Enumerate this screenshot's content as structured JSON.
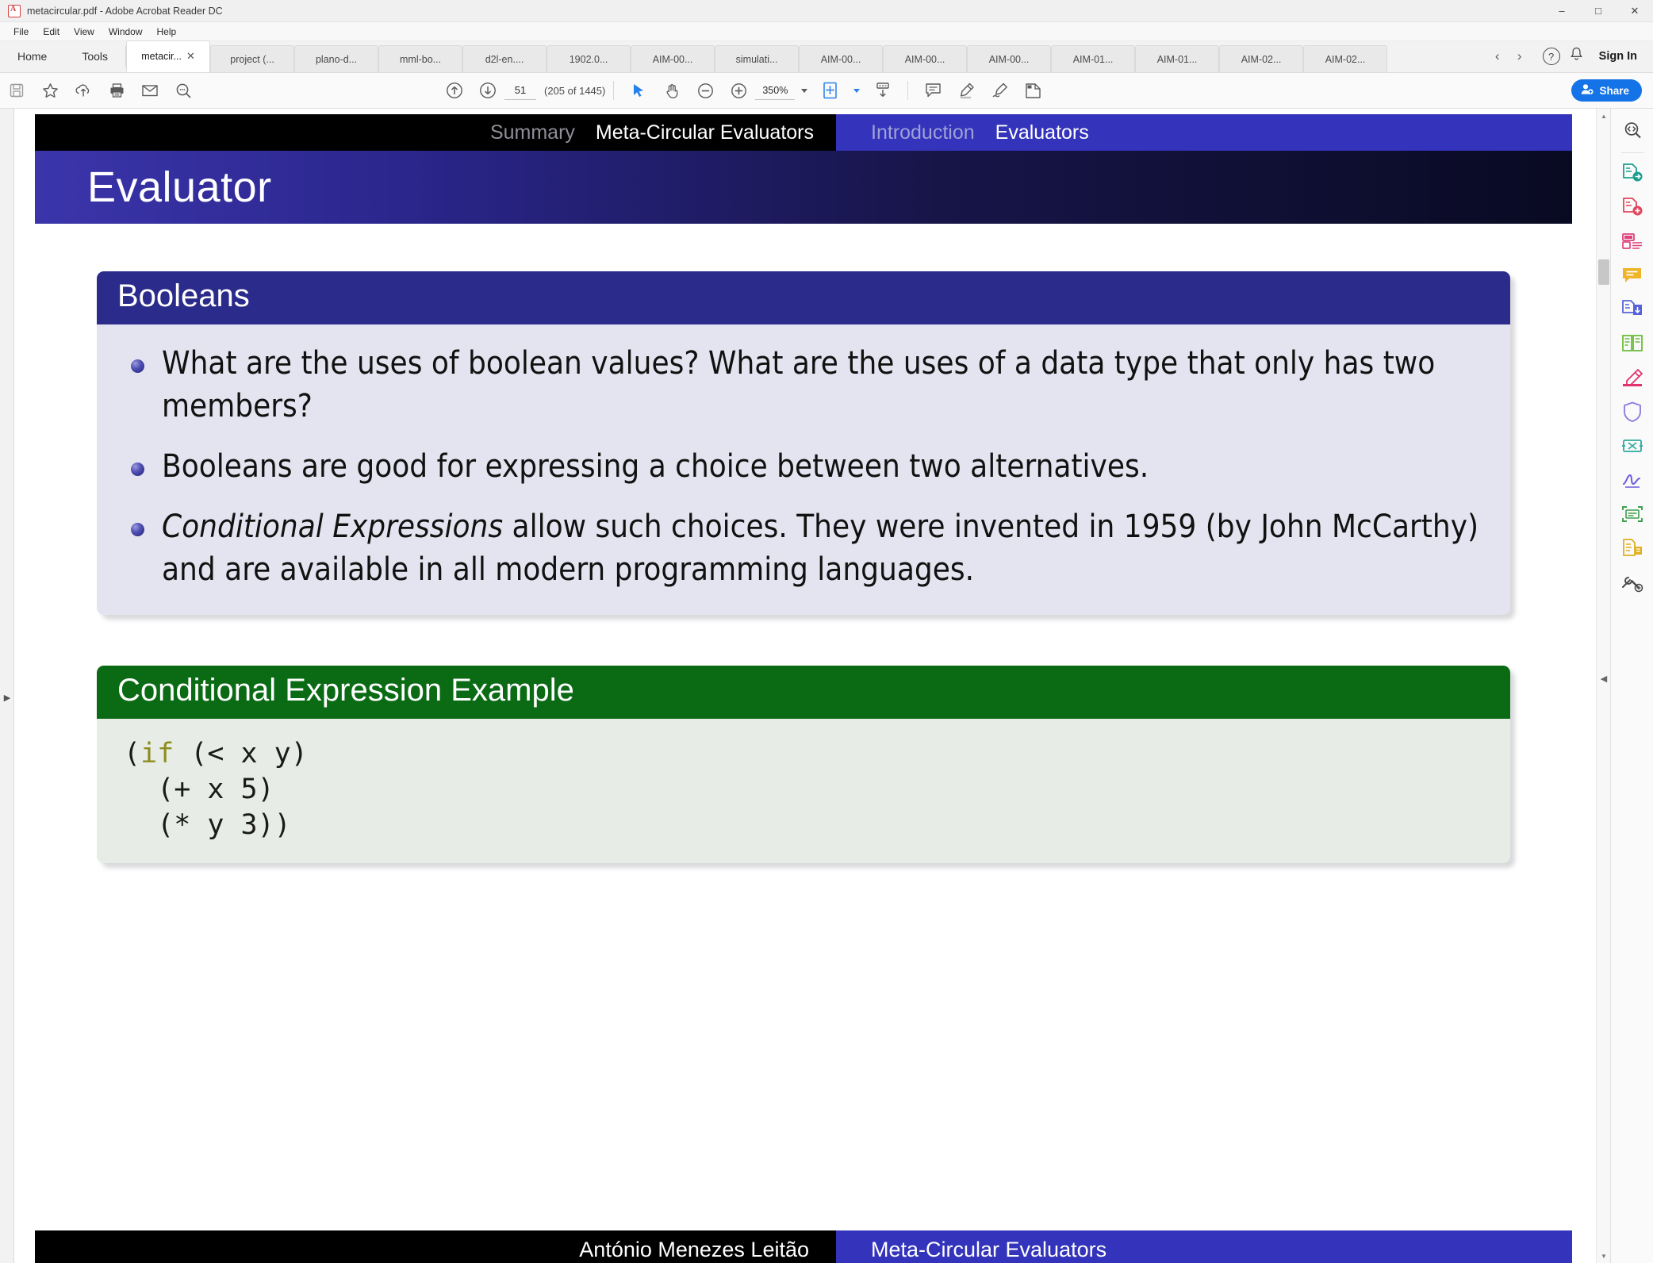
{
  "window": {
    "title": "metacircular.pdf - Adobe Acrobat Reader DC",
    "app_icon": "pdf-document-icon",
    "minimize": "–",
    "maximize": "□",
    "close": "✕"
  },
  "menubar": {
    "items": [
      {
        "label": "File"
      },
      {
        "label": "Edit"
      },
      {
        "label": "View"
      },
      {
        "label": "Window"
      },
      {
        "label": "Help"
      }
    ]
  },
  "tabbar": {
    "home_label": "Home",
    "tools_label": "Tools",
    "close_glyph": "✕",
    "prev_glyph": "‹",
    "next_glyph": "›",
    "help_glyph": "?",
    "bell_glyph": "🔔",
    "signin_label": "Sign In",
    "documents": [
      {
        "label": "metacir...",
        "active": true
      },
      {
        "label": "project (...",
        "active": false
      },
      {
        "label": "plano-d...",
        "active": false
      },
      {
        "label": "mml-bo...",
        "active": false
      },
      {
        "label": "d2l-en....",
        "active": false
      },
      {
        "label": "1902.0...",
        "active": false
      },
      {
        "label": "AIM-00...",
        "active": false
      },
      {
        "label": "simulati...",
        "active": false
      },
      {
        "label": "AIM-00...",
        "active": false
      },
      {
        "label": "AIM-00...",
        "active": false
      },
      {
        "label": "AIM-00...",
        "active": false
      },
      {
        "label": "AIM-01...",
        "active": false
      },
      {
        "label": "AIM-01...",
        "active": false
      },
      {
        "label": "AIM-02...",
        "active": false
      },
      {
        "label": "AIM-02...",
        "active": false
      }
    ]
  },
  "toolbar": {
    "save_icon": "save-disk-icon",
    "star_icon": "star-icon",
    "cloud_icon": "cloud-upload-icon",
    "print_icon": "print-icon",
    "email_icon": "email-icon",
    "findzoom_icon": "search-zoom-icon",
    "page_up_icon": "page-up-icon",
    "page_down_icon": "page-down-icon",
    "page_number": "51",
    "page_total": "(205 of 1445)",
    "select_icon": "cursor-select-icon",
    "hand_icon": "hand-pan-icon",
    "zoom_out_icon": "zoom-out-icon",
    "zoom_in_icon": "zoom-in-icon",
    "zoom_level": "350%",
    "fit_page_icon": "fit-page-icon",
    "scroll_mode_icon": "scroll-mode-icon",
    "comment_icon": "comment-icon",
    "highlight_icon": "highlight-icon",
    "draw_icon": "draw-freehand-icon",
    "fillsign_icon": "fill-and-sign-icon",
    "share_label": "Share",
    "share_icon": "person-add-icon"
  },
  "right_rail": {
    "items": [
      {
        "icon": "search-page-icon",
        "color": "#4a4a4a"
      },
      {
        "icon": "export-pdf-icon",
        "color": "#1a9e8f"
      },
      {
        "icon": "create-pdf-icon",
        "color": "#e2465c"
      },
      {
        "icon": "edit-pdf-icon",
        "color": "#e0407c"
      },
      {
        "icon": "comment-tool-icon",
        "color": "#f0b429"
      },
      {
        "icon": "combine-files-icon",
        "color": "#5663d6"
      },
      {
        "icon": "organize-pages-icon",
        "color": "#6dbd3c"
      },
      {
        "icon": "redact-icon",
        "color": "#e2326b"
      },
      {
        "icon": "protect-icon",
        "color": "#8b7fe0"
      },
      {
        "icon": "compress-pdf-icon",
        "color": "#2fa9a0"
      },
      {
        "icon": "signature-icon",
        "color": "#6a5ade"
      },
      {
        "icon": "scan-ocr-icon",
        "color": "#3f9e4d"
      },
      {
        "icon": "prepare-form-icon",
        "color": "#e0b01f"
      },
      {
        "icon": "more-tools-icon",
        "color": "#4a4a4a"
      }
    ]
  },
  "scrollbar": {
    "up_glyph": "▲",
    "down_glyph": "▼",
    "left_panel_glyph": "▶",
    "right_panel_glyph": "◀"
  },
  "slide": {
    "nav_left": [
      {
        "label": "Summary",
        "active": false
      },
      {
        "label": "Meta-Circular Evaluators",
        "active": true
      }
    ],
    "nav_right": [
      {
        "label": "Introduction",
        "active": false
      },
      {
        "label": "Evaluators",
        "active": true
      }
    ],
    "title": "Evaluator",
    "blocks": [
      {
        "heading": "Booleans",
        "style": "blue",
        "bullets": [
          "What are the uses of boolean values?  What are the uses of a data type that only has two members?",
          "Booleans are good for expressing a choice between two alternatives.",
          "Conditional Expressions allow such choices.  They were invented in 1959 (by John McCarthy) and are available in all modern programming languages."
        ],
        "bullet3_italic_lead": "Conditional Expressions",
        "bullet3_rest": " allow such choices.  They were invented in 1959 (by John McCarthy) and are available in all modern programming languages."
      },
      {
        "heading": "Conditional Expression Example",
        "style": "green",
        "code_keyword": "if",
        "code_before": "(",
        "code_after": " (< x y)\n  (+ x 5)\n  (* y 3))"
      }
    ],
    "footer_left": "António Menezes Leitão",
    "footer_right": "Meta-Circular Evaluators",
    "nav_symbols": {
      "back_glyph": "↶",
      "search_glyph": "⌕",
      "forward_glyph": "↷"
    }
  },
  "colors": {
    "beamer_blue": "#3333bb",
    "block_blue": "#2b2b8c",
    "block_green": "#0b6b14",
    "block_body_lavender": "#e4e4f0",
    "block_body_green": "#e7ece6",
    "accent_share": "#1473e6",
    "code_keyword": "#8d8d1f"
  }
}
